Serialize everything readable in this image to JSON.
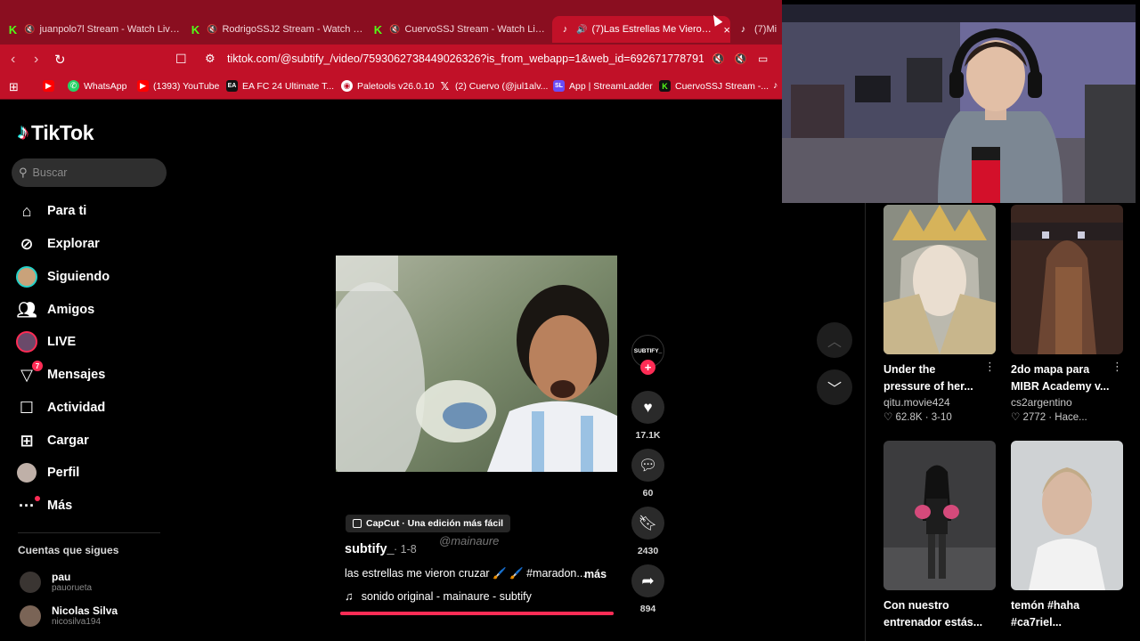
{
  "browser": {
    "tabs": [
      {
        "icon": "kick",
        "title": "juanpolo7l Stream - Watch Live o"
      },
      {
        "icon": "kick",
        "title": "RodrigoSSJ2 Stream - Watch Live"
      },
      {
        "icon": "kick",
        "title": "CuervoSSJ Stream - Watch Live o"
      },
      {
        "icon": "tiktok",
        "title": "(7)Las Estrellas Me Vieron Cru",
        "close": "×"
      },
      {
        "icon": "tiktok",
        "title": "(7)Mi"
      }
    ],
    "url": "tiktok.com/@subtify_/video/7593062738449026326?is_from_webapp=1&web_id=6926717787911357...",
    "bookmarks": [
      {
        "icon": "youtube",
        "label": ""
      },
      {
        "icon": "whatsapp",
        "label": "WhatsApp"
      },
      {
        "icon": "youtube",
        "label": "(1393) YouTube"
      },
      {
        "icon": "ea",
        "label": "EA FC 24 Ultimate T..."
      },
      {
        "icon": "paletools",
        "label": "Paletools v26.0.10"
      },
      {
        "icon": "x",
        "label": "(2) Cuervo (@jul1alv..."
      },
      {
        "icon": "streamladder",
        "label": "App | StreamLadder"
      },
      {
        "icon": "kick",
        "label": "CuervoSSJ Stream -..."
      }
    ]
  },
  "sidebar": {
    "brand": "TikTok",
    "search_placeholder": "Buscar",
    "nav": [
      {
        "label": "Para ti",
        "icon": "home-icon"
      },
      {
        "label": "Explorar",
        "icon": "compass-icon"
      },
      {
        "label": "Siguiendo",
        "icon": "following-avatar"
      },
      {
        "label": "Amigos",
        "icon": "friends-icon"
      },
      {
        "label": "LIVE",
        "icon": "live-avatar"
      },
      {
        "label": "Mensajes",
        "icon": "messages-icon",
        "badge": "7"
      },
      {
        "label": "Actividad",
        "icon": "activity-icon"
      },
      {
        "label": "Cargar",
        "icon": "upload-icon"
      },
      {
        "label": "Perfil",
        "icon": "profile-avatar"
      },
      {
        "label": "Más",
        "icon": "more-icon"
      }
    ],
    "following_header": "Cuentas que sigues",
    "following": [
      {
        "name": "pau",
        "handle": "pauorueta"
      },
      {
        "name": "Nicolas Silva",
        "handle": "nicosilva194"
      }
    ]
  },
  "video": {
    "capcut_label": "CapCut · Una edición más fácil",
    "author": "subtify_",
    "date": "· 1-8",
    "watermark": "@mainaure",
    "caption": "las estrellas me vieron cruzar 🖌️ 🖌️ #maradon...",
    "more_label": "más",
    "sound": "sonido original - mainaure - subtify",
    "progress": 1.0,
    "creator_avatar_text": "SUBTIFY_",
    "likes": "17.1K",
    "comments": "60",
    "saves": "2430",
    "shares": "894"
  },
  "related": [
    {
      "title": "Under the pressure of her...",
      "user": "qitu.movie424",
      "stats": "♡ 62.8K · 3-10"
    },
    {
      "title": "2do mapa para MIBR Academy v...",
      "user": "cs2argentino",
      "stats": "♡ 2772 · Hace..."
    },
    {
      "title": "Con nuestro entrenador estás...",
      "user": "",
      "stats": ""
    },
    {
      "title": "temón #haha #ca7riel...",
      "user": "",
      "stats": ""
    }
  ],
  "colors": {
    "accent": "#fe2c55",
    "browser": "#c11128",
    "teal": "#25f4ee"
  }
}
